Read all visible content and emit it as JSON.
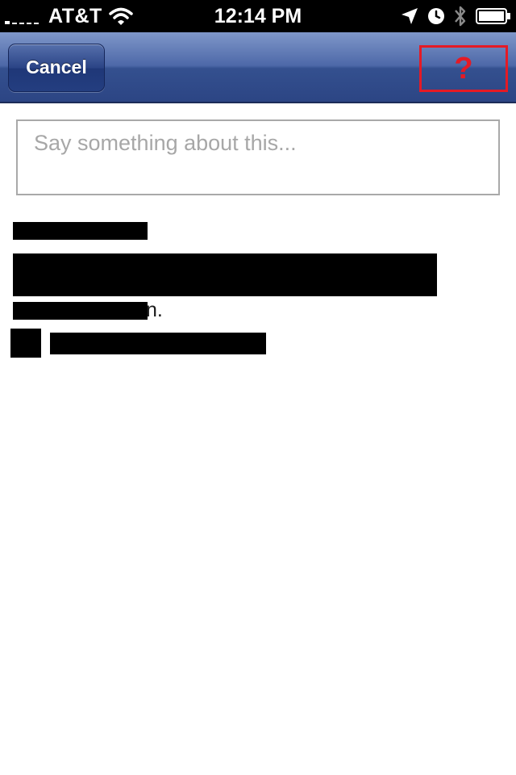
{
  "status_bar": {
    "carrier": "AT&T",
    "time": "12:14 PM",
    "icons": [
      "signal-bars-icon",
      "wifi-icon",
      "location-arrow-icon",
      "alarm-clock-icon",
      "bluetooth-icon",
      "battery-icon"
    ]
  },
  "nav": {
    "cancel_label": "Cancel",
    "help_label": "?"
  },
  "comment": {
    "placeholder": "Say something about this..."
  },
  "shared": {
    "trailing_text": "n."
  },
  "colors": {
    "nav_blue": "#2c4584",
    "help_red": "#e51a25",
    "placeholder_gray": "#a7a7a7"
  }
}
